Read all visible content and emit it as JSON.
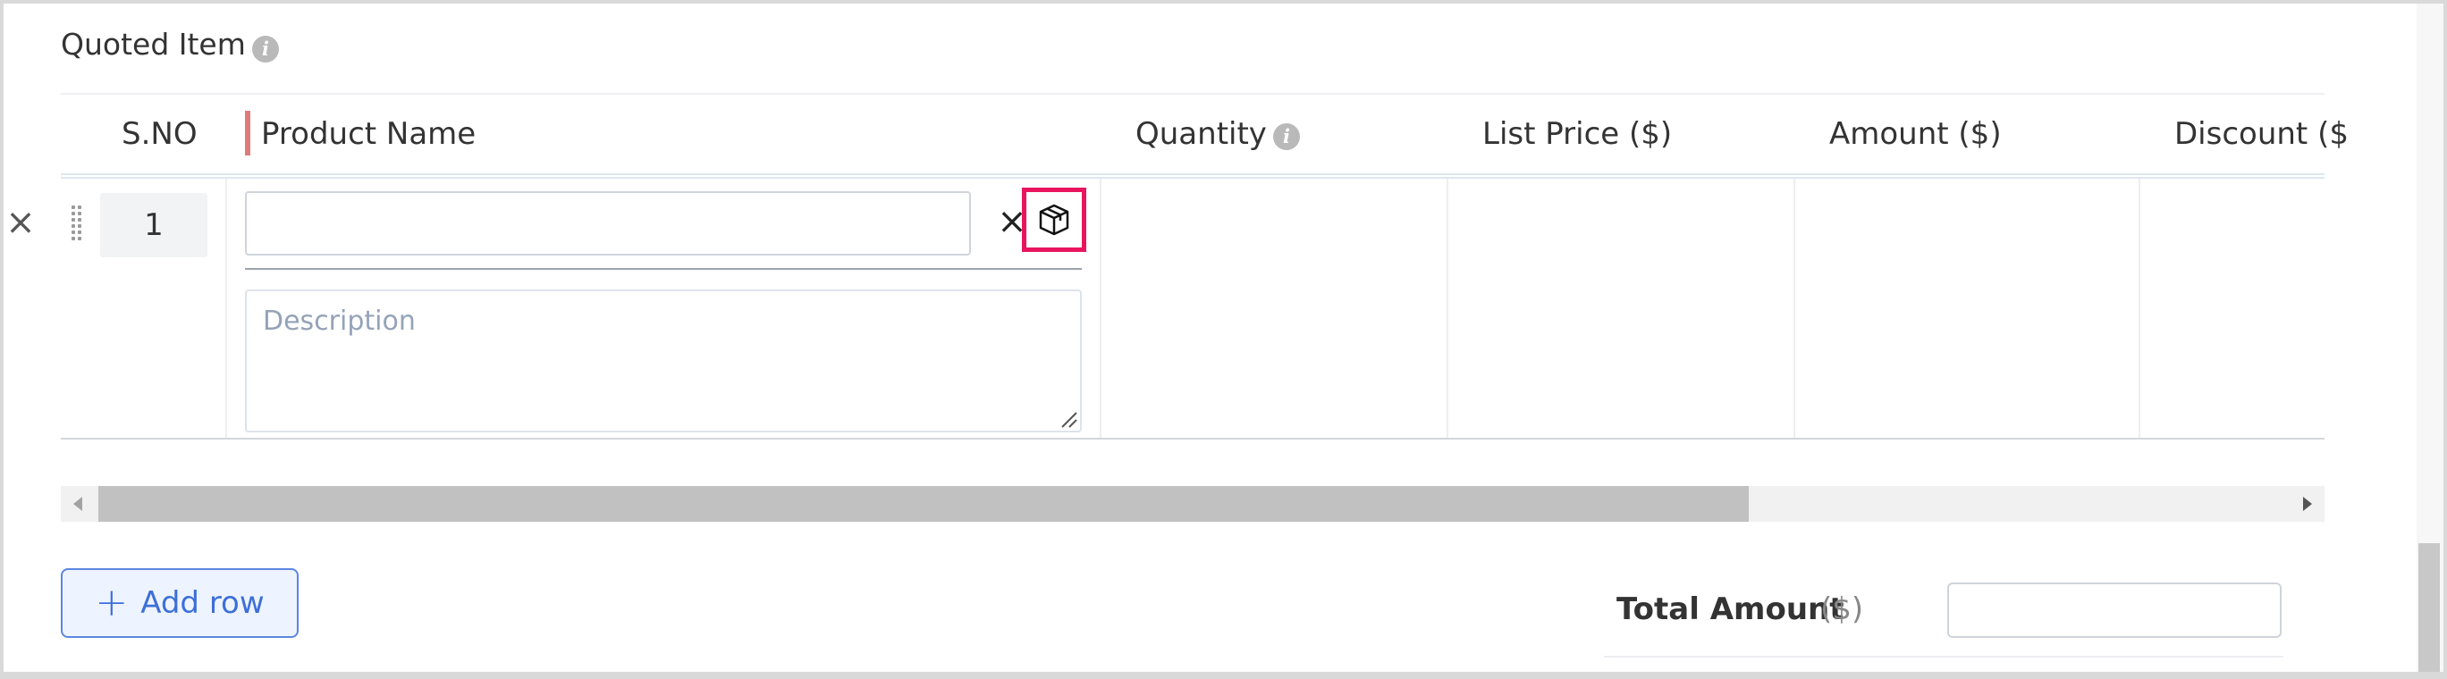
{
  "section": {
    "title": "Quoted Item",
    "info_glyph": "i"
  },
  "columns": {
    "sno": "S.NO",
    "product_name": "Product Name",
    "quantity": "Quantity",
    "list_price": "List Price ($)",
    "amount": "Amount ($)",
    "discount": "Discount ($"
  },
  "row": {
    "number": "1",
    "product_value": "",
    "description_placeholder": "Description",
    "remove_glyph": "×",
    "clear_glyph": "×"
  },
  "footer": {
    "add_row_label": "Add row",
    "add_row_icon": "+",
    "total_label": "Total Amount",
    "total_currency": "($)",
    "total_value": ""
  },
  "icons": [
    "info-icon",
    "close-icon",
    "drag-handle-icon",
    "product-box-icon",
    "plus-icon",
    "resize-grip-icon"
  ],
  "colors": {
    "accent": "#3d6fd8",
    "highlight": "#e8155e",
    "required": "#e07b7b"
  }
}
